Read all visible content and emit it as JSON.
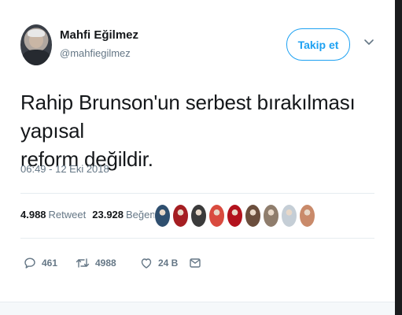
{
  "author": {
    "name": "Mahfi Eğilmez",
    "handle": "@mahfiegilmez"
  },
  "follow_button": {
    "label": "Takip et"
  },
  "tweet": {
    "text_line1": "Rahip Brunson'un serbest bırakılması yapısal",
    "text_line2": "reform değildir.",
    "timestamp": "06:49 - 12 Eki 2018"
  },
  "stats": {
    "retweet_count": "4.988",
    "retweet_label": "Retweet",
    "like_count": "23.928",
    "like_label": "Beğeni"
  },
  "likers": [
    {
      "name": "liker-1",
      "color": "#2f4f6f"
    },
    {
      "name": "liker-2",
      "color": "#a51e22"
    },
    {
      "name": "liker-3",
      "color": "#3b3b3b"
    },
    {
      "name": "liker-4",
      "color": "#d94b3f"
    },
    {
      "name": "liker-5",
      "color": "#b3121d"
    },
    {
      "name": "liker-6",
      "color": "#6b4e3d"
    },
    {
      "name": "liker-7",
      "color": "#8f7d6c"
    },
    {
      "name": "liker-8",
      "color": "#c5ced6"
    },
    {
      "name": "liker-9",
      "color": "#c98a6a"
    }
  ],
  "actions": {
    "reply_count": "461",
    "retweet_count": "4988",
    "like_count": "24 B"
  },
  "colors": {
    "accent": "#1da1f2",
    "secondary_text": "#657786",
    "divider": "#e6ecf0"
  },
  "icons": {
    "chevron": "chevron-down-icon",
    "reply": "reply-icon",
    "retweet": "retweet-icon",
    "like": "heart-icon",
    "message": "direct-message-icon"
  }
}
